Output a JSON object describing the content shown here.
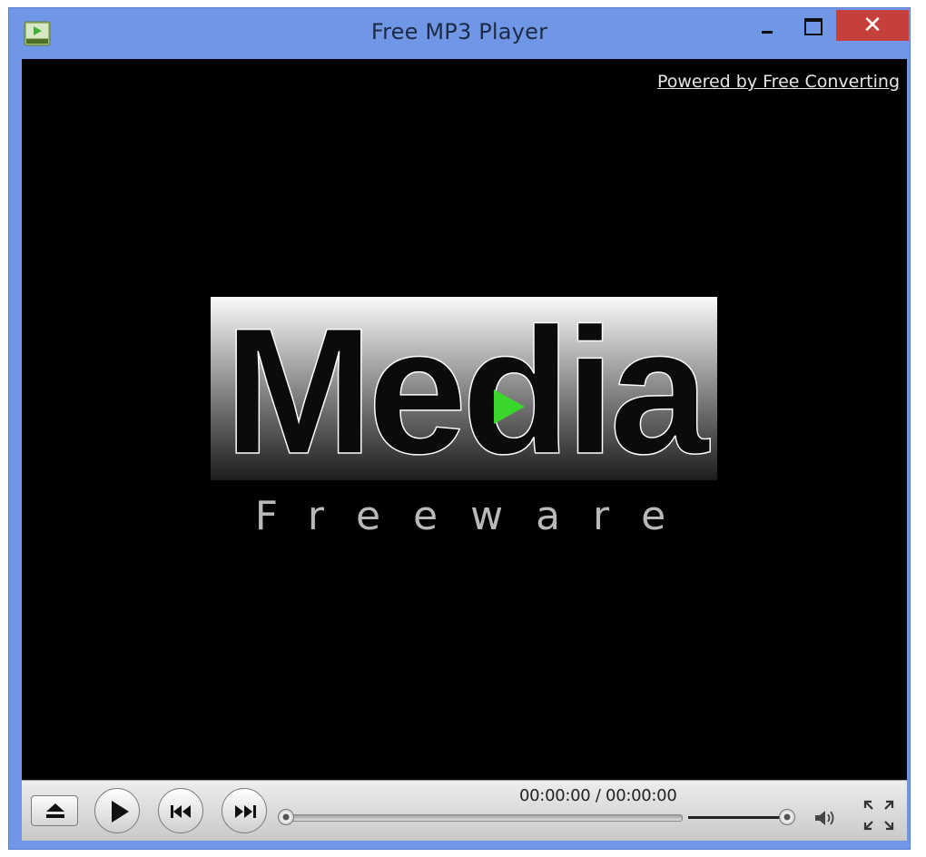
{
  "window": {
    "title": "Free MP3 Player",
    "icon": "media-player-app-icon",
    "controls": [
      "minimize-icon",
      "maximize-icon",
      "close-icon"
    ],
    "close_glyph": "✕",
    "accent_color": "#6f97e6",
    "close_color": "#c6403b"
  },
  "video": {
    "powered_by_link": "Powered by Free Converting",
    "logo_main": "Media",
    "logo_sub": "Freeware",
    "logo_play_color": "#3bd62c",
    "background": "#000000"
  },
  "controls": {
    "eject": "eject-icon",
    "play": "play-icon",
    "previous": "previous-track-icon",
    "next": "next-track-icon",
    "time_display": "00:00:00 / 00:00:00",
    "seek_position": 0,
    "volume_level": 1.0,
    "volume_icon": "speaker-icon",
    "fullscreen_icon": "fullscreen-icon"
  }
}
